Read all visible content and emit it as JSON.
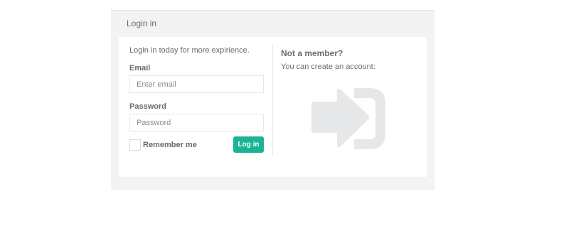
{
  "panel": {
    "title": "Login in"
  },
  "login": {
    "intro": "Login in today for more expirience.",
    "email_label": "Email",
    "email_placeholder": "Enter email",
    "email_value": "",
    "password_label": "Password",
    "password_placeholder": "Password",
    "password_value": "",
    "remember_label": "Remember me",
    "remember_checked": false,
    "submit_label": "Log in"
  },
  "signup": {
    "title": "Not a member?",
    "text": "You can create an account:",
    "icon": "sign-in-icon"
  },
  "colors": {
    "primary": "#1ab394",
    "panel_background": "#f3f3f4",
    "text": "#676a6c",
    "icon": "#e6e7e8"
  }
}
